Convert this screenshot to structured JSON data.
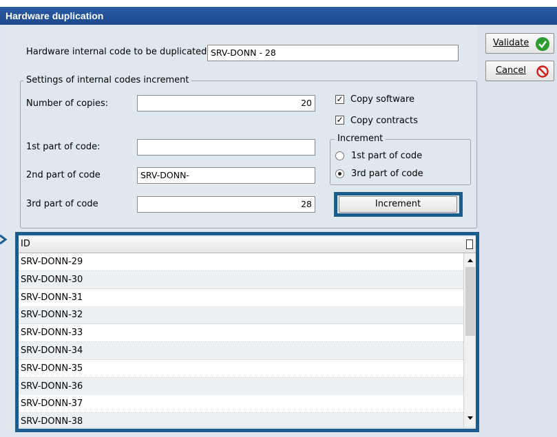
{
  "window": {
    "title": "Hardware duplication"
  },
  "form": {
    "source_label": "Hardware internal code to be duplicated:",
    "source_value": "SRV-DONN - 28",
    "settings_title": "Settings of internal codes increment",
    "copies_label": "Number of copies:",
    "copies_value": "20",
    "part1_label": "1st part of code:",
    "part1_value": "",
    "part2_label": "2nd part of code",
    "part2_value": "SRV-DONN-",
    "part3_label": "3rd part of code",
    "part3_value": "28",
    "copy_software_label": "Copy software",
    "copy_software_checked": true,
    "copy_contracts_label": "Copy contracts",
    "copy_contracts_checked": true,
    "increment_group_title": "Increment",
    "radio_1st_label": "1st part of code",
    "radio_3rd_label": "3rd part of code",
    "selected_increment": "3rd part of code",
    "increment_button": "Increment"
  },
  "actions": {
    "validate_label": "Validate",
    "cancel_label": "Cancel",
    "validate_icon": "green-check-icon",
    "cancel_icon": "red-no-icon"
  },
  "grid": {
    "header_id": "ID",
    "rows": [
      "SRV-DONN-29",
      "SRV-DONN-30",
      "SRV-DONN-31",
      "SRV-DONN-32",
      "SRV-DONN-33",
      "SRV-DONN-34",
      "SRV-DONN-35",
      "SRV-DONN-36",
      "SRV-DONN-37",
      "SRV-DONN-38"
    ]
  },
  "colors": {
    "titlebar": "#1d4a8c",
    "highlight": "#1a5c8c",
    "validate": "#2e9b2e",
    "cancel": "#d11a1a"
  }
}
